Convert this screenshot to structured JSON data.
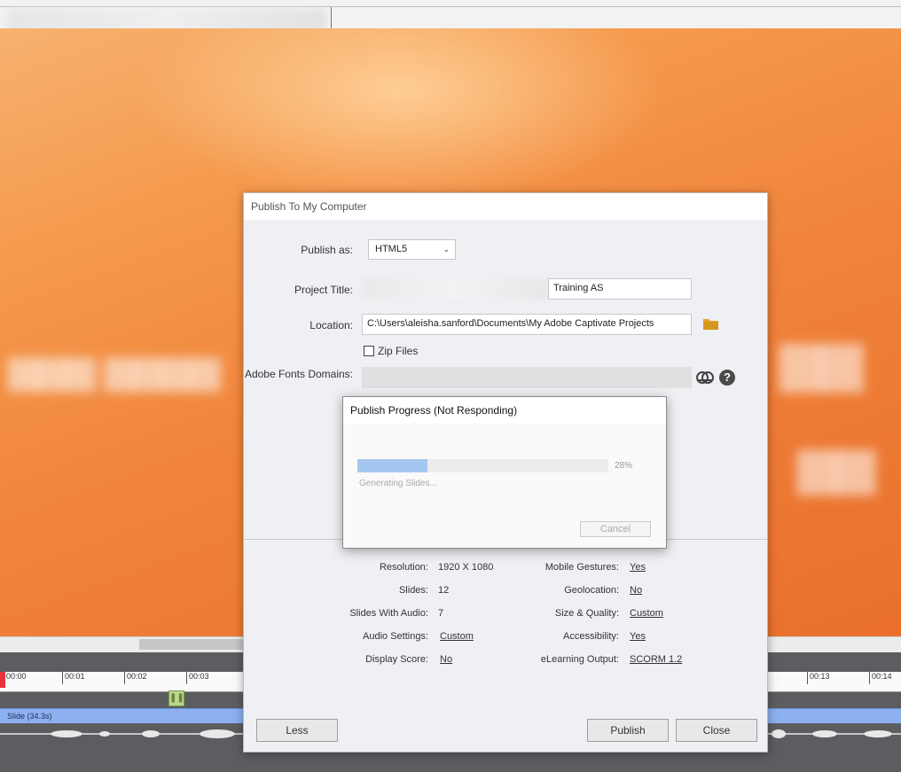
{
  "publish_dialog": {
    "title": "Publish To My Computer",
    "publish_as": {
      "label": "Publish as:",
      "value": "HTML5"
    },
    "project_title": {
      "label": "Project Title:",
      "value": "Training AS"
    },
    "location": {
      "label": "Location:",
      "value": "C:\\Users\\aleisha.sanford\\Documents\\My Adobe Captivate Projects"
    },
    "zip_files": {
      "label": "Zip Files",
      "checked": false
    },
    "fonts_domains": {
      "label": "Adobe Fonts Domains:"
    },
    "info_left": [
      {
        "label": "Resolution:",
        "value": "1920 X 1080",
        "link": false
      },
      {
        "label": "Slides:",
        "value": "12",
        "link": false
      },
      {
        "label": "Slides With Audio:",
        "value": "7",
        "link": false
      },
      {
        "label": "Audio Settings:",
        "value": "Custom",
        "link": true
      },
      {
        "label": "Display Score:",
        "value": "No",
        "link": true
      }
    ],
    "info_right": [
      {
        "label": "Mobile Gestures:",
        "value": "Yes",
        "link": true
      },
      {
        "label": "Geolocation:",
        "value": "No",
        "link": true
      },
      {
        "label": "Size & Quality:",
        "value": "Custom",
        "link": true
      },
      {
        "label": "Accessibility:",
        "value": "Yes",
        "link": true
      },
      {
        "label": "eLearning Output:",
        "value": "SCORM 1.2",
        "link": true
      }
    ],
    "buttons": {
      "less": "Less",
      "publish": "Publish",
      "close": "Close"
    }
  },
  "progress_dialog": {
    "title": "Publish Progress (Not Responding)",
    "percent": 28,
    "percent_label": "28%",
    "status": "Generating Slides...",
    "cancel": "Cancel"
  },
  "timeline": {
    "ticks_left": [
      "00:00",
      "00:01",
      "00:02",
      "00:03"
    ],
    "ticks_right": [
      "00:13",
      "00:14"
    ],
    "slide_label": "Slide (34.3s)"
  },
  "icons": {
    "folder": "folder-icon",
    "creative_cloud": "creative-cloud-icon",
    "help": "help-icon",
    "chevron": "chevron-down-icon"
  },
  "colors": {
    "stage_orange": "#f0833a",
    "progress_fill": "#a5c6ef",
    "folder_yellow": "#e3a52a",
    "slide_track": "#8db0f0",
    "playhead": "#e8323c"
  }
}
